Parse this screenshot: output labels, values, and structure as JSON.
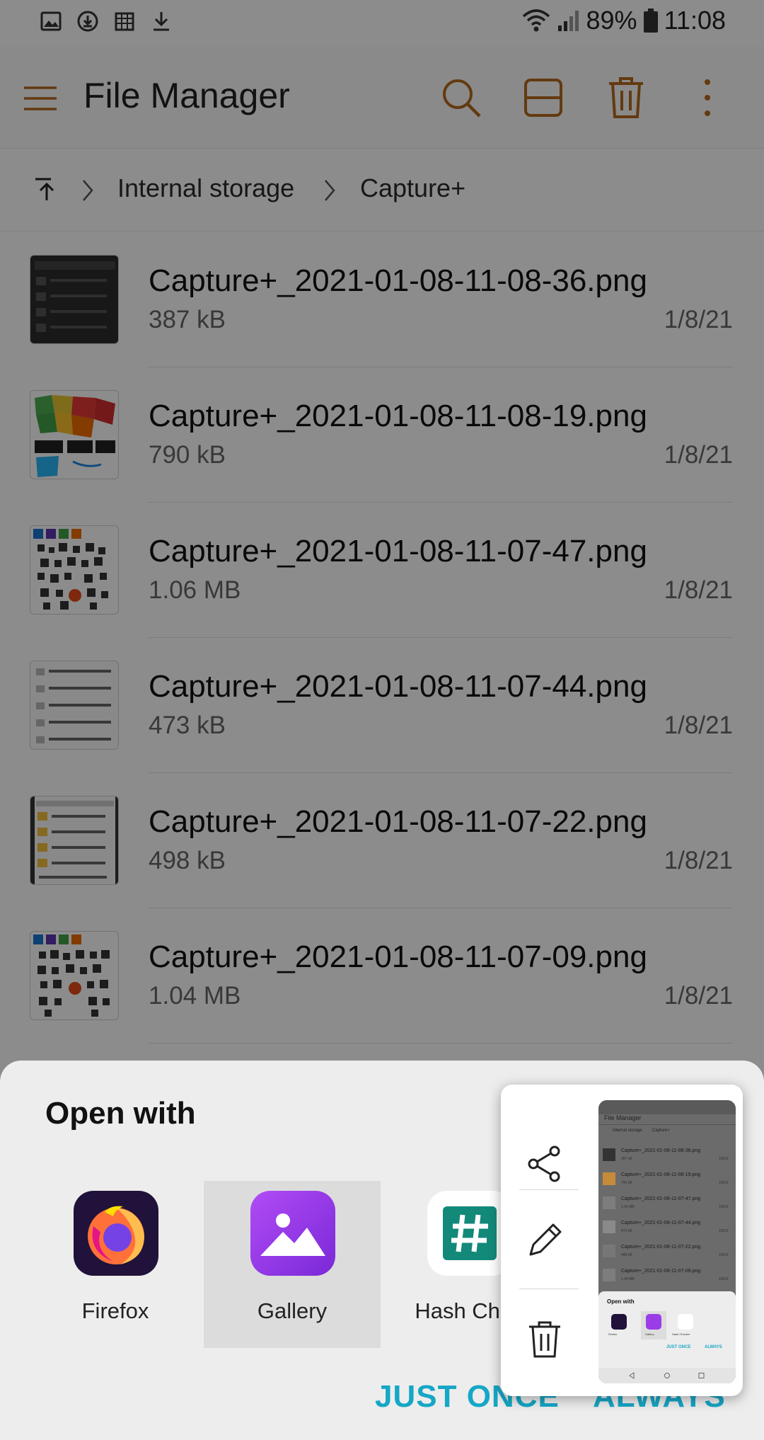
{
  "status_bar": {
    "battery": "89%",
    "time": "11:08",
    "left_icons": [
      "image-icon",
      "download-circle-icon",
      "calendar-grid-icon",
      "download-icon"
    ],
    "right_icons": [
      "wifi-icon",
      "signal-icon",
      "battery-icon"
    ]
  },
  "app_bar": {
    "title": "File Manager",
    "accent_color": "#b56a1e",
    "icons": [
      "menu-icon",
      "search-icon",
      "view-layout-icon",
      "delete-icon",
      "more-vert-icon"
    ]
  },
  "breadcrumb": {
    "items": [
      "Internal storage",
      "Capture+"
    ]
  },
  "files": [
    {
      "name": "Capture+_2021-01-08-11-08-36.png",
      "size": "387 kB",
      "date": "1/8/21"
    },
    {
      "name": "Capture+_2021-01-08-11-08-19.png",
      "size": "790 kB",
      "date": "1/8/21"
    },
    {
      "name": "Capture+_2021-01-08-11-07-47.png",
      "size": "1.06 MB",
      "date": "1/8/21"
    },
    {
      "name": "Capture+_2021-01-08-11-07-44.png",
      "size": "473 kB",
      "date": "1/8/21"
    },
    {
      "name": "Capture+_2021-01-08-11-07-22.png",
      "size": "498 kB",
      "date": "1/8/21"
    },
    {
      "name": "Capture+_2021-01-08-11-07-09.png",
      "size": "1.04 MB",
      "date": "1/8/21"
    }
  ],
  "open_with": {
    "title": "Open with",
    "apps": [
      {
        "label": "Firefox",
        "icon": "firefox-icon"
      },
      {
        "label": "Gallery",
        "icon": "gallery-icon"
      },
      {
        "label": "Hash Chec",
        "icon": "hash-icon"
      }
    ],
    "just_once": "JUST ONCE",
    "always": "ALWAYS",
    "button_color": "#15a7c6"
  },
  "screenshot_popup": {
    "actions": [
      "share-icon",
      "edit-pencil-icon",
      "delete-icon"
    ],
    "preview": {
      "title": "File Manager",
      "breadcrumb": [
        "Internal storage",
        "Capture+"
      ],
      "files": [
        {
          "name": "Capture+_2021-01-08-11-08-36.png",
          "size": "387 kB",
          "date": "1/8/21"
        },
        {
          "name": "Capture+_2021-01-08-11-08-19.png",
          "size": "790 kB",
          "date": "1/8/21"
        },
        {
          "name": "Capture+_2021-01-08-11-07-47.png",
          "size": "1.06 MB",
          "date": "1/8/21"
        },
        {
          "name": "Capture+_2021-01-08-11-07-44.png",
          "size": "473 kB",
          "date": "1/8/21"
        },
        {
          "name": "Capture+_2021-01-08-11-07-22.png",
          "size": "498 kB",
          "date": "1/8/21"
        },
        {
          "name": "Capture+_2021-01-08-11-07-09.png",
          "size": "1.04 MB",
          "date": "1/8/21"
        }
      ],
      "open_with": "Open with",
      "apps": [
        "Firefox",
        "Gallery",
        "Hash Checker"
      ],
      "just_once": "JUST ONCE",
      "always": "ALWAYS"
    }
  }
}
